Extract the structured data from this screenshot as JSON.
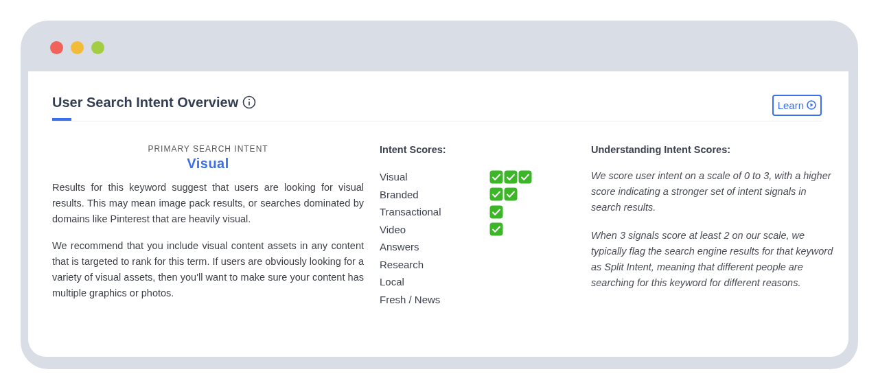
{
  "window": {
    "controls": [
      {
        "color": "#f0625a"
      },
      {
        "color": "#f2bb3a"
      },
      {
        "color": "#a3cd43"
      }
    ]
  },
  "header": {
    "title": "User Search Intent Overview",
    "learn_button": "Learn"
  },
  "primary": {
    "label": "PRIMARY SEARCH INTENT",
    "value": "Visual",
    "paragraphs": [
      "Results for this keyword suggest that users are looking for visual results. This may mean image pack results, or searches dominated by domains like Pinterest that are heavily visual.",
      "We recommend that you include visual content assets in any content that is targeted to rank for this term. If users are obviously looking for a variety of visual assets, then you'll want to make sure your content has multiple graphics or photos."
    ]
  },
  "scores": {
    "title": "Intent Scores:",
    "items": [
      {
        "name": "Visual",
        "checks": [
          {
            "kind": "check"
          },
          {
            "kind": "check"
          },
          {
            "kind": "check"
          }
        ]
      },
      {
        "name": "Branded",
        "checks": [
          {
            "kind": "check"
          },
          {
            "kind": "check"
          }
        ]
      },
      {
        "name": "Transactional",
        "checks": [
          {
            "kind": "check"
          }
        ]
      },
      {
        "name": "Video",
        "checks": [
          {
            "kind": "check"
          }
        ]
      },
      {
        "name": "Answers"
      },
      {
        "name": "Research"
      },
      {
        "name": "Local"
      },
      {
        "name": "Fresh / News"
      }
    ]
  },
  "explanation": {
    "title": "Understanding Intent Scores:",
    "paragraphs": [
      "We score user intent on a scale of 0 to 3, with a higher score indicating a stronger set of intent signals in search results.",
      "When 3 signals score at least 2 on our scale, we typically flag the search engine results for that keyword as Split Intent, meaning that different people are searching for this keyword for different reasons."
    ]
  }
}
